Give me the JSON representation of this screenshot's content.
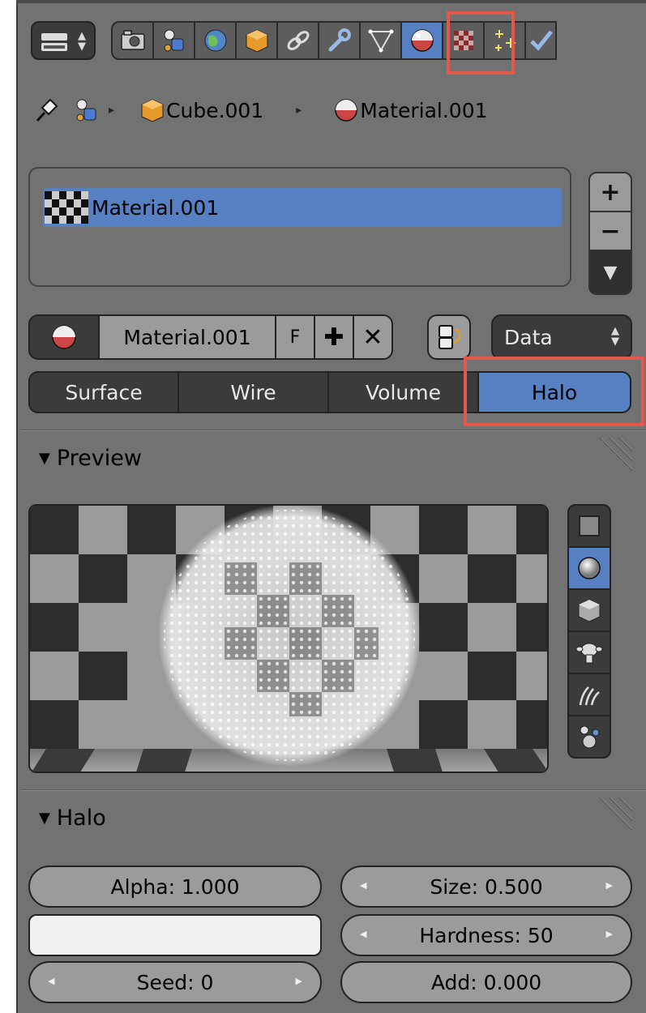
{
  "header": {
    "tabs": [
      {
        "name": "render",
        "icon": "camera-icon"
      },
      {
        "name": "render-layers",
        "icon": "render-layers-icon"
      },
      {
        "name": "world",
        "icon": "world-icon"
      },
      {
        "name": "object",
        "icon": "cube-icon"
      },
      {
        "name": "constraints",
        "icon": "link-icon"
      },
      {
        "name": "modifiers",
        "icon": "wrench-icon"
      },
      {
        "name": "data",
        "icon": "mesh-data-icon"
      },
      {
        "name": "material",
        "icon": "material-sphere-icon",
        "active": true
      },
      {
        "name": "texture",
        "icon": "checker-texture-icon"
      },
      {
        "name": "particles",
        "icon": "particles-icon"
      },
      {
        "name": "physics",
        "icon": "physics-icon"
      }
    ]
  },
  "breadcrumb": {
    "object": "Cube.001",
    "material": "Material.001"
  },
  "slots": {
    "items": [
      "Material.001"
    ],
    "add_symbol": "+",
    "remove_symbol": "−",
    "menu_symbol": "▼"
  },
  "idblock": {
    "name": "Material.001",
    "fake_user": "F",
    "add_symbol": "✚",
    "unlink_symbol": "✕",
    "link_dropdown": "Data",
    "dropdown_arrows": "▲\n▼"
  },
  "material_types": {
    "surface": "Surface",
    "wire": "Wire",
    "volume": "Volume",
    "halo": "Halo",
    "active": "Halo"
  },
  "preview_panel": {
    "title": "Preview",
    "shapes": [
      "flat-plane-icon",
      "sphere-icon",
      "cube-icon",
      "monkey-icon",
      "hair-strands-icon",
      "sphere-cluster-icon"
    ],
    "active_shape": "sphere-icon"
  },
  "halo_panel": {
    "title": "Halo",
    "alpha": "Alpha: 1.000",
    "size": "Size: 0.500",
    "hardness": "Hardness: 50",
    "seed": "Seed: 0",
    "add": "Add: 0.000",
    "color": "#f0f0f0"
  },
  "highlight_color": "#e5564b",
  "accent_color": "#5680c2",
  "glyphs": {
    "triangle_down": "▼",
    "arrow_left": "◀",
    "arrow_right": "▶",
    "crumb_sep": "▸"
  }
}
